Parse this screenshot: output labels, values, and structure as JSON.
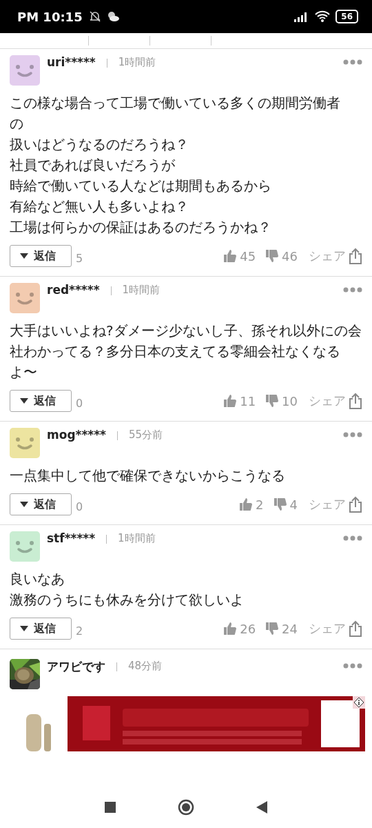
{
  "status_bar": {
    "time": "PM 10:15",
    "battery": "56"
  },
  "comments": [
    {
      "user": "uri*****",
      "time": "1時間前",
      "avatar": {
        "kind": "face",
        "color": "#e3cdee"
      },
      "body": [
        "この様な場合って工場で働いている多くの期間労働者",
        "の",
        "扱いはどうなるのだろうね？",
        "社員であれば良いだろうが",
        "時給で働いている人などは期間もあるから",
        "有給など無い人も多いよね？",
        "工場は何らかの保証はあるのだろうかね？"
      ],
      "reply_label": "返信",
      "reply_count": "5",
      "likes": "45",
      "dislikes": "46",
      "share_label": "シェア"
    },
    {
      "user": "red*****",
      "time": "1時間前",
      "avatar": {
        "kind": "face",
        "color": "#f3cbb0"
      },
      "body": [
        "大手はいいよね?ダメージ少ないし子、孫それ以外にの会社わかってる？多分日本の支えてる零細会社なくなるよ〜"
      ],
      "reply_label": "返信",
      "reply_count": "0",
      "likes": "11",
      "dislikes": "10",
      "share_label": "シェア"
    },
    {
      "user": "mog*****",
      "time": "55分前",
      "avatar": {
        "kind": "face",
        "color": "#ede4a0"
      },
      "body": [
        "一点集中して他で確保できないからこうなる"
      ],
      "reply_label": "返信",
      "reply_count": "0",
      "likes": "2",
      "dislikes": "4",
      "share_label": "シェア"
    },
    {
      "user": "stf*****",
      "time": "1時間前",
      "avatar": {
        "kind": "face",
        "color": "#c9edd2"
      },
      "body": [
        "良いなあ",
        "激務のうちにも休みを分けて欲しいよ"
      ],
      "reply_label": "返信",
      "reply_count": "2",
      "likes": "26",
      "dislikes": "24",
      "share_label": "シェア"
    },
    {
      "user": "アワビです",
      "time": "48分前"
    }
  ]
}
